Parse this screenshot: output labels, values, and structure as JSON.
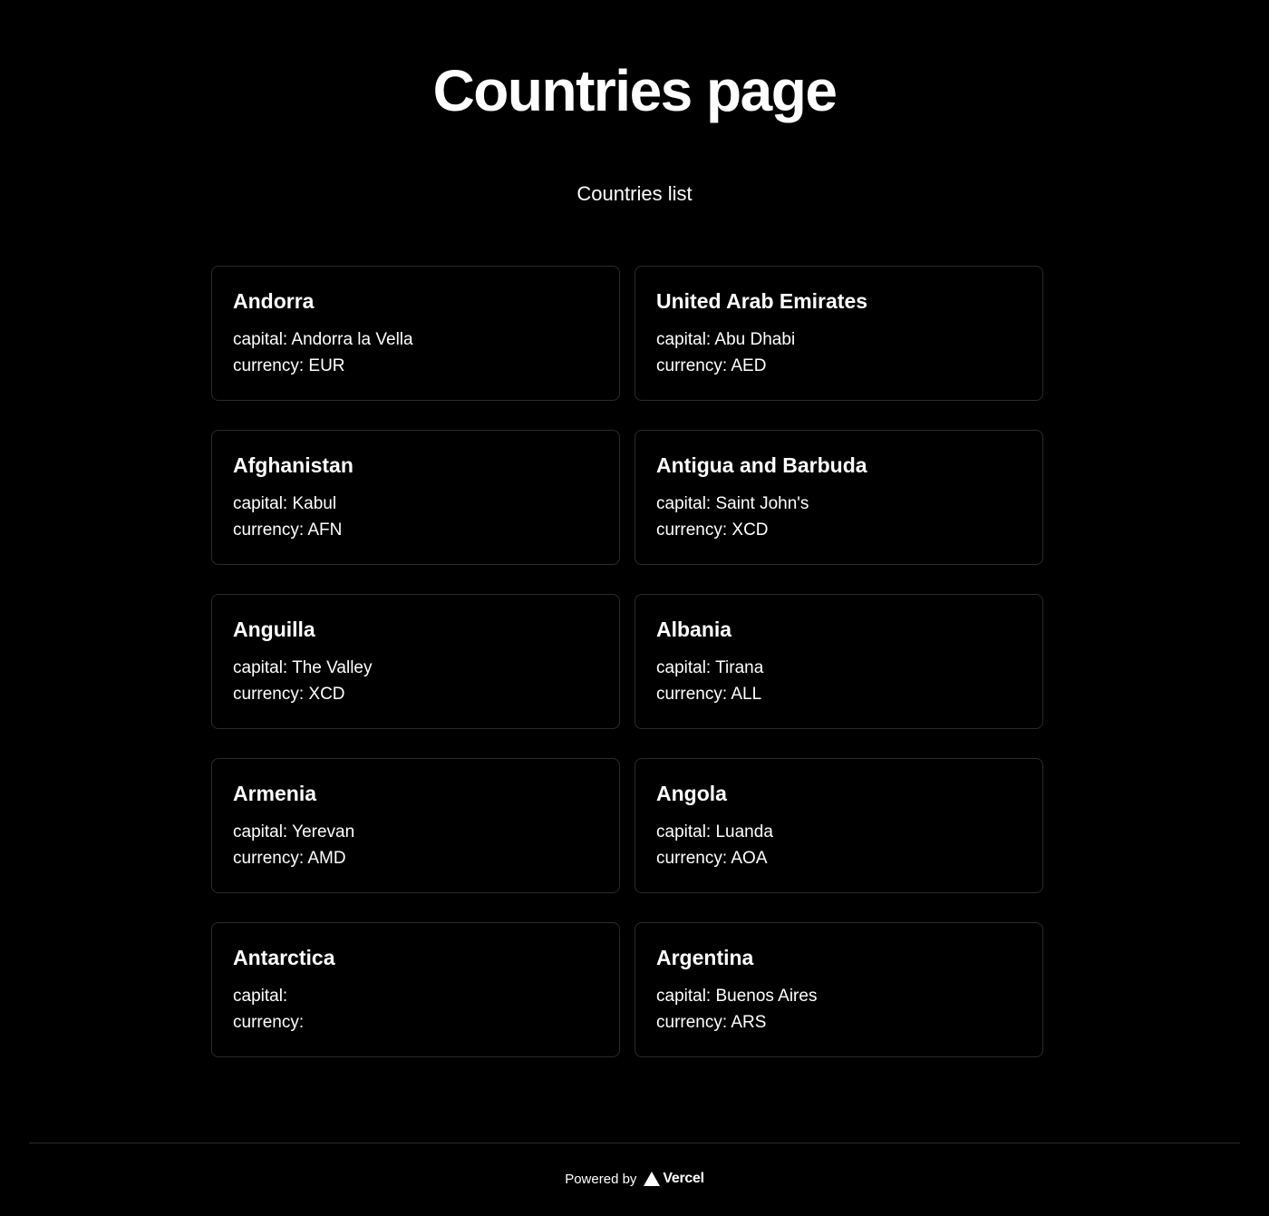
{
  "header": {
    "title": "Countries page",
    "subtitle": "Countries list"
  },
  "countries": [
    {
      "name": "Andorra",
      "capital": "capital: Andorra la Vella",
      "currency": "currency: EUR"
    },
    {
      "name": "United Arab Emirates",
      "capital": "capital: Abu Dhabi",
      "currency": "currency: AED"
    },
    {
      "name": "Afghanistan",
      "capital": "capital: Kabul",
      "currency": "currency: AFN"
    },
    {
      "name": "Antigua and Barbuda",
      "capital": "capital: Saint John's",
      "currency": "currency: XCD"
    },
    {
      "name": "Anguilla",
      "capital": "capital: The Valley",
      "currency": "currency: XCD"
    },
    {
      "name": "Albania",
      "capital": "capital: Tirana",
      "currency": "currency: ALL"
    },
    {
      "name": "Armenia",
      "capital": "capital: Yerevan",
      "currency": "currency: AMD"
    },
    {
      "name": "Angola",
      "capital": "capital: Luanda",
      "currency": "currency: AOA"
    },
    {
      "name": "Antarctica",
      "capital": "capital:",
      "currency": "currency:"
    },
    {
      "name": "Argentina",
      "capital": "capital: Buenos Aires",
      "currency": "currency: ARS"
    }
  ],
  "footer": {
    "powered_by": "Powered by",
    "brand": "Vercel",
    "brand_icon": "vercel-triangle-icon"
  },
  "colors": {
    "background": "#000000",
    "text": "#ffffff",
    "border": "#2a2a2a"
  }
}
